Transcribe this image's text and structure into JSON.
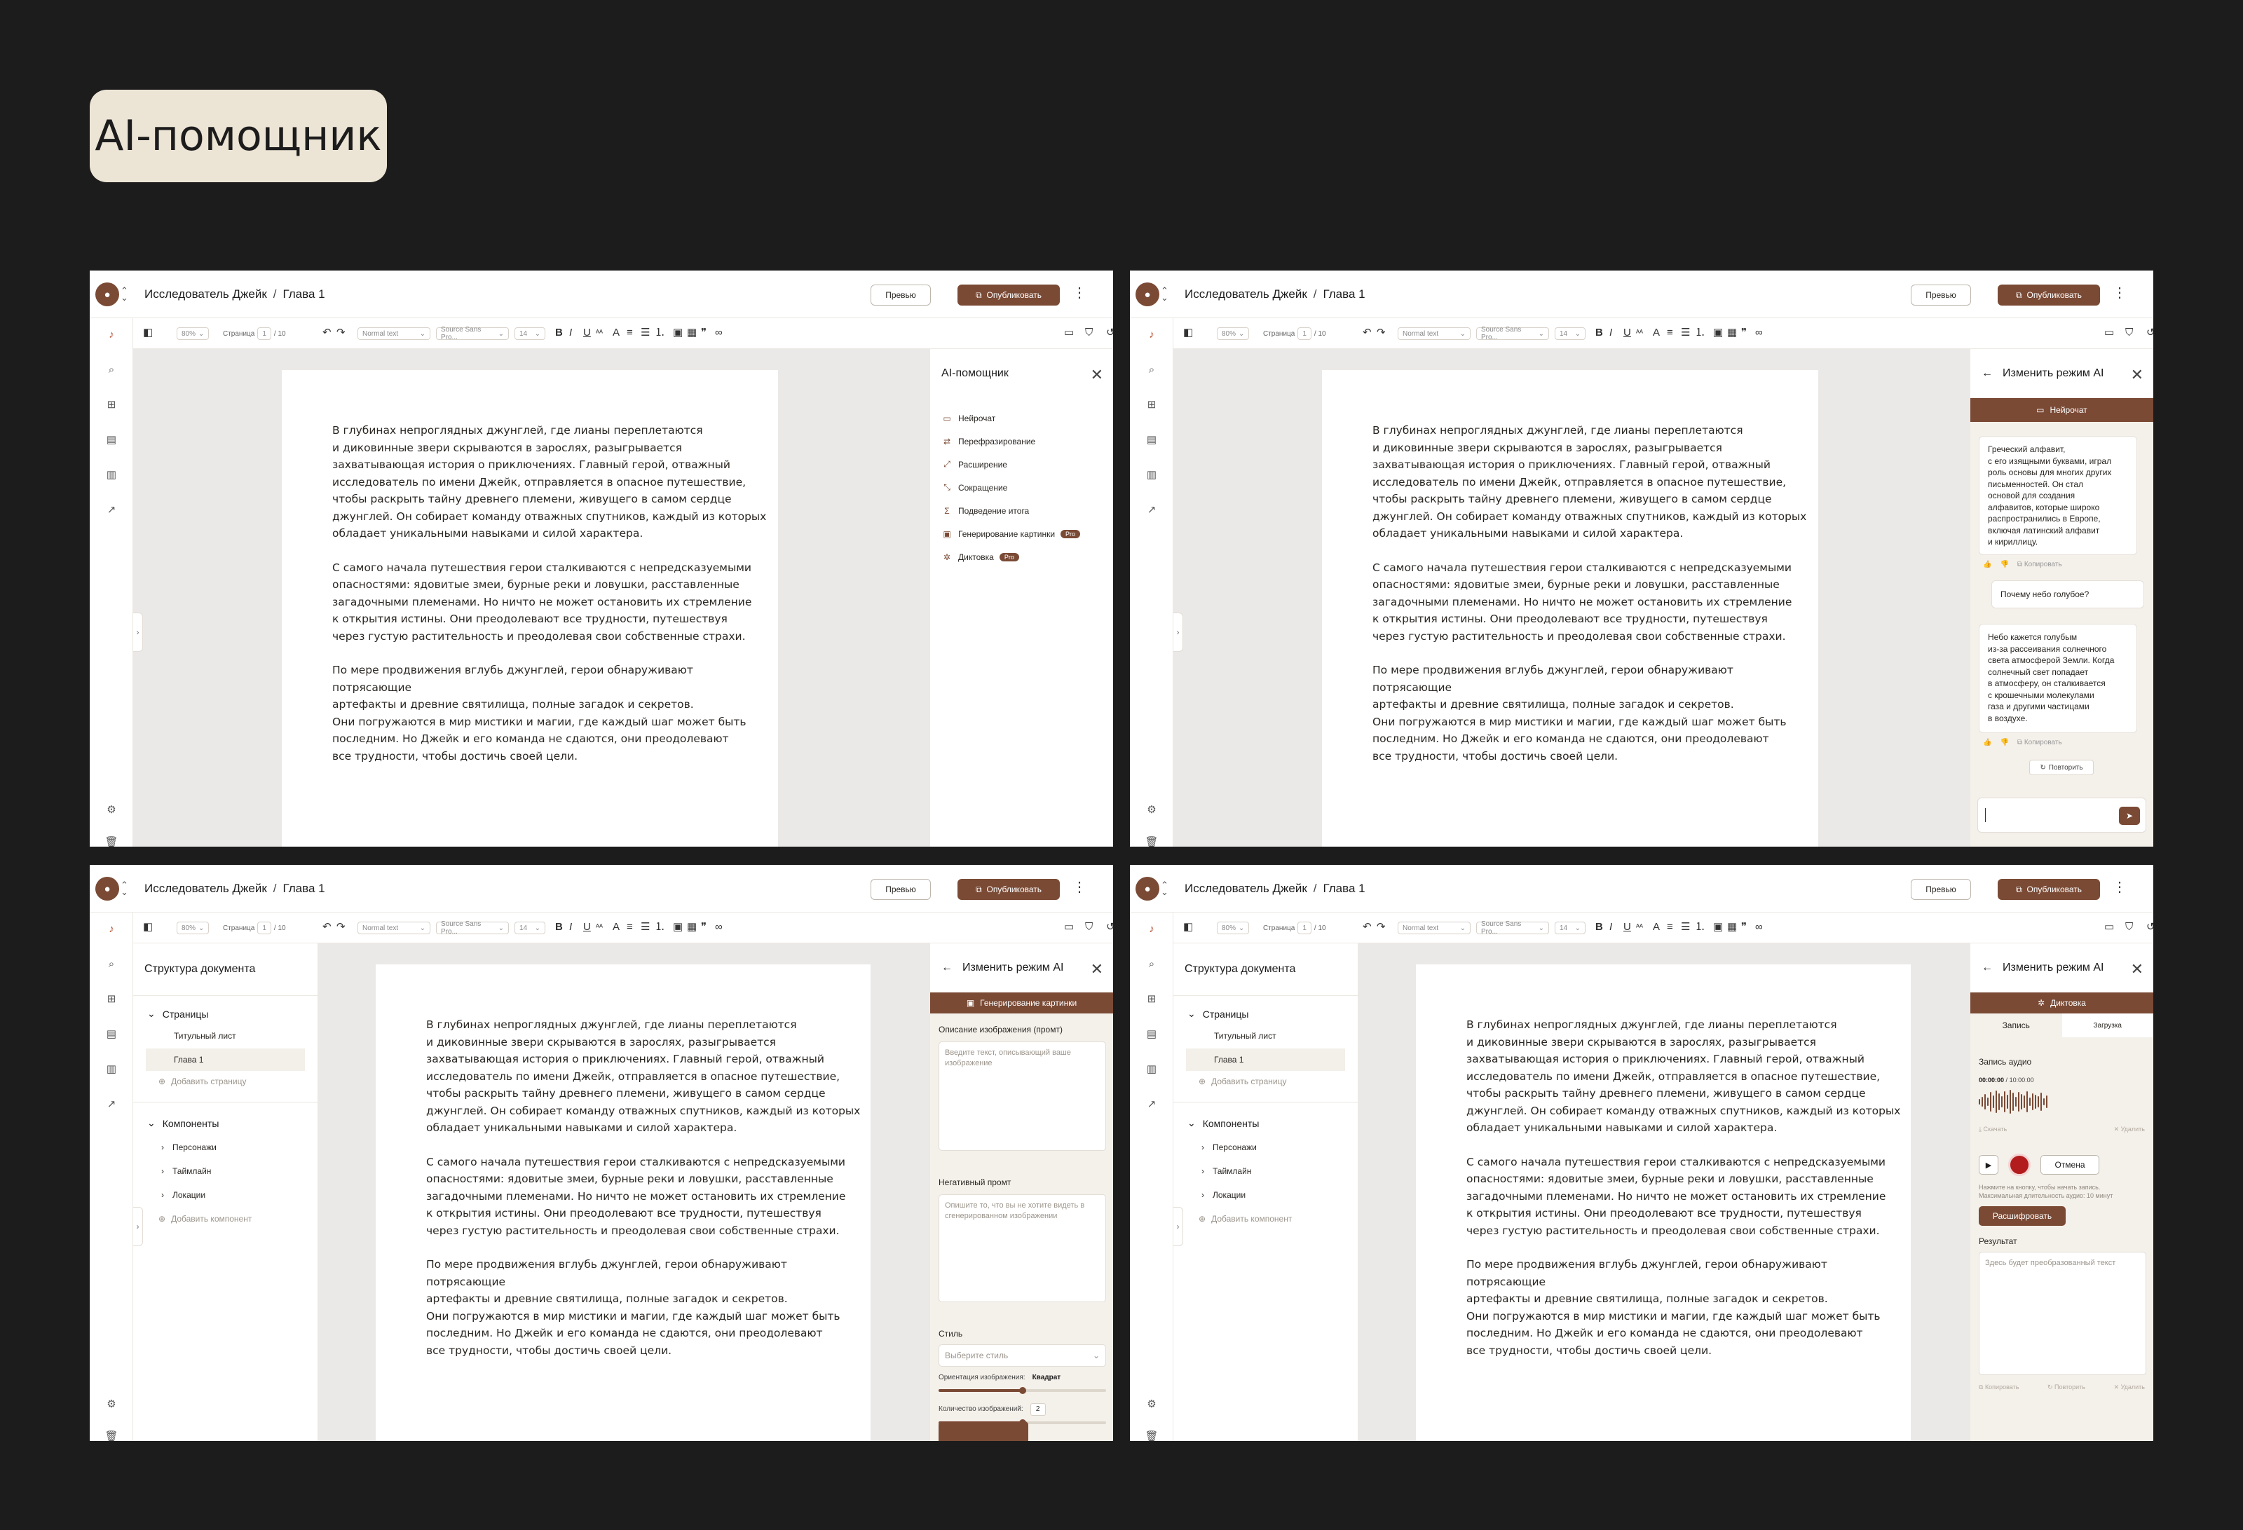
{
  "hero": {
    "title": "AI-помощник"
  },
  "app": {
    "breadcrumb": {
      "project": "Исследователь Джейк",
      "separator": "/",
      "chapter": "Глава 1"
    },
    "preview_label": "Превью",
    "publish_label": "Опубликовать",
    "toolbar": {
      "zoom": "80%",
      "pages_label": "Страница",
      "page_current": "1",
      "page_total": "/ 10",
      "text_style": "Normal text",
      "font": "Source Sans Pro...",
      "font_size": "14"
    },
    "document": {
      "paragraphs": [
        "В глубинах непроглядных джунглей, где лианы переплетаются\nи диковинные звери скрываются в зарослях, разыгрывается\nзахватывающая история о приключениях. Главный герой, отважный\nисследователь по имени Джейк, отправляется в опасное путешествие,\nчтобы раскрыть тайну древнего племени, живущего в самом сердце\nджунглей. Он собирает команду отважных спутников, каждый из которых\nобладает уникальными навыками и силой характера.",
        "С самого начала путешествия герои сталкиваются с непредсказуемыми\nопасностями: ядовитые змеи, бурные реки и ловушки, расставленные\nзагадочными племенами. Но ничто не может остановить их стремление\nк открытия истины. Они преодолевают все трудности, путешествуя\nчерез густую растительность и преодолевая свои собственные страхи.",
        "По мере продвижения вглубь джунглей, герои обнаруживают потрясающие\nартефакты и древние святилища, полные загадок и секретов.\nОни погружаются в мир мистики и магии, где каждый шаг может быть\nпоследним. Но Джейк и его команда не сдаются, они преодолевают\nвсе трудности, чтобы достичь своей цели."
      ]
    }
  },
  "ai_panel": {
    "title": "AI-помощник",
    "items": [
      {
        "icon": "chat-icon",
        "label": "Нейрочат",
        "pro": ""
      },
      {
        "icon": "paraphrase-icon",
        "label": "Перефразирование",
        "pro": ""
      },
      {
        "icon": "expand-icon",
        "label": "Расширение",
        "pro": ""
      },
      {
        "icon": "shorten-icon",
        "label": "Сокращение",
        "pro": ""
      },
      {
        "icon": "summary-icon",
        "label": "Подведение итога",
        "pro": ""
      },
      {
        "icon": "image-icon",
        "label": "Генерирование картинки",
        "pro": "Pro"
      },
      {
        "icon": "dictation-icon",
        "label": "Диктовка",
        "pro": "Pro"
      }
    ]
  },
  "mode_panel": {
    "title": "Изменить режим AI",
    "chat_mode": "Нейрочат",
    "image_mode": "Генерирование картинки",
    "dictation_mode": "Диктовка"
  },
  "chat": {
    "answer1": "Греческий алфавит,\nс его изящными буквами, играл\nроль основы для многих других\nписьменностей. Он стал\nосновой для создания\nалфавитов, которые широко\nраспространились в Европе,\nвключая латинский алфавит\nи кириллицу.",
    "question": "Почему небо голубое?",
    "answer2": "Небо кажется голубым\nиз-за рассеивания солнечного\nсвета атмосферой Земли. Когда\nсолнечный свет попадает\nв атмосферу, он сталкивается\nс крошечными молекулами\nгаза и другими частицами\nв воздухе.",
    "copy_label": "Копировать",
    "retry_label": "Повторить"
  },
  "image_form": {
    "prompt_label": "Описание изображения (промт)",
    "prompt_placeholder": "Введите текст, описывающий ваше изображение",
    "negative_label": "Негативный промт",
    "negative_placeholder": "Опишите то, что вы не хотите видеть в сгенерированном изображении",
    "style_label": "Стиль",
    "style_placeholder": "Выберите стиль",
    "orientation_label": "Ориентация изображения:",
    "orientation_value": "Квадрат",
    "orientation_level": 0.5,
    "count_label": "Количество изображений:",
    "count_value": "2",
    "count_level": 0.5
  },
  "structure": {
    "title": "Структура документа",
    "pages_group": "Страницы",
    "pages": [
      "Титульный лист",
      "Глава 1"
    ],
    "add_page": "Добавить страницу",
    "components_group": "Компоненты",
    "components": [
      "Персонажи",
      "Таймлайн",
      "Локации"
    ],
    "add_component": "Добавить компонент"
  },
  "dictation": {
    "tab_record": "Запись",
    "tab_upload": "Загрузка",
    "audio_label": "Запись аудио",
    "time_current": "00:00:00",
    "time_sep": "/",
    "time_max": "10:00:00",
    "download_label": "Скачать",
    "delete_label": "Удалить",
    "cancel_label": "Отмена",
    "hint": "Нажмите на кнопку, чтобы начать запись.\nМаксимальная длительность аудио: 10 минут",
    "decode_label": "Расшифровать",
    "result_label": "Результат",
    "result_placeholder": "Здесь будет преобразованный текст",
    "copy_label": "Копировать",
    "repeat_label": "Повторить",
    "delete_result_label": "Удалить"
  },
  "colors": {
    "brand": "#7a4a35",
    "beige": "#ece4d5",
    "background": "#1d1c1c",
    "record": "#b31c1c"
  }
}
